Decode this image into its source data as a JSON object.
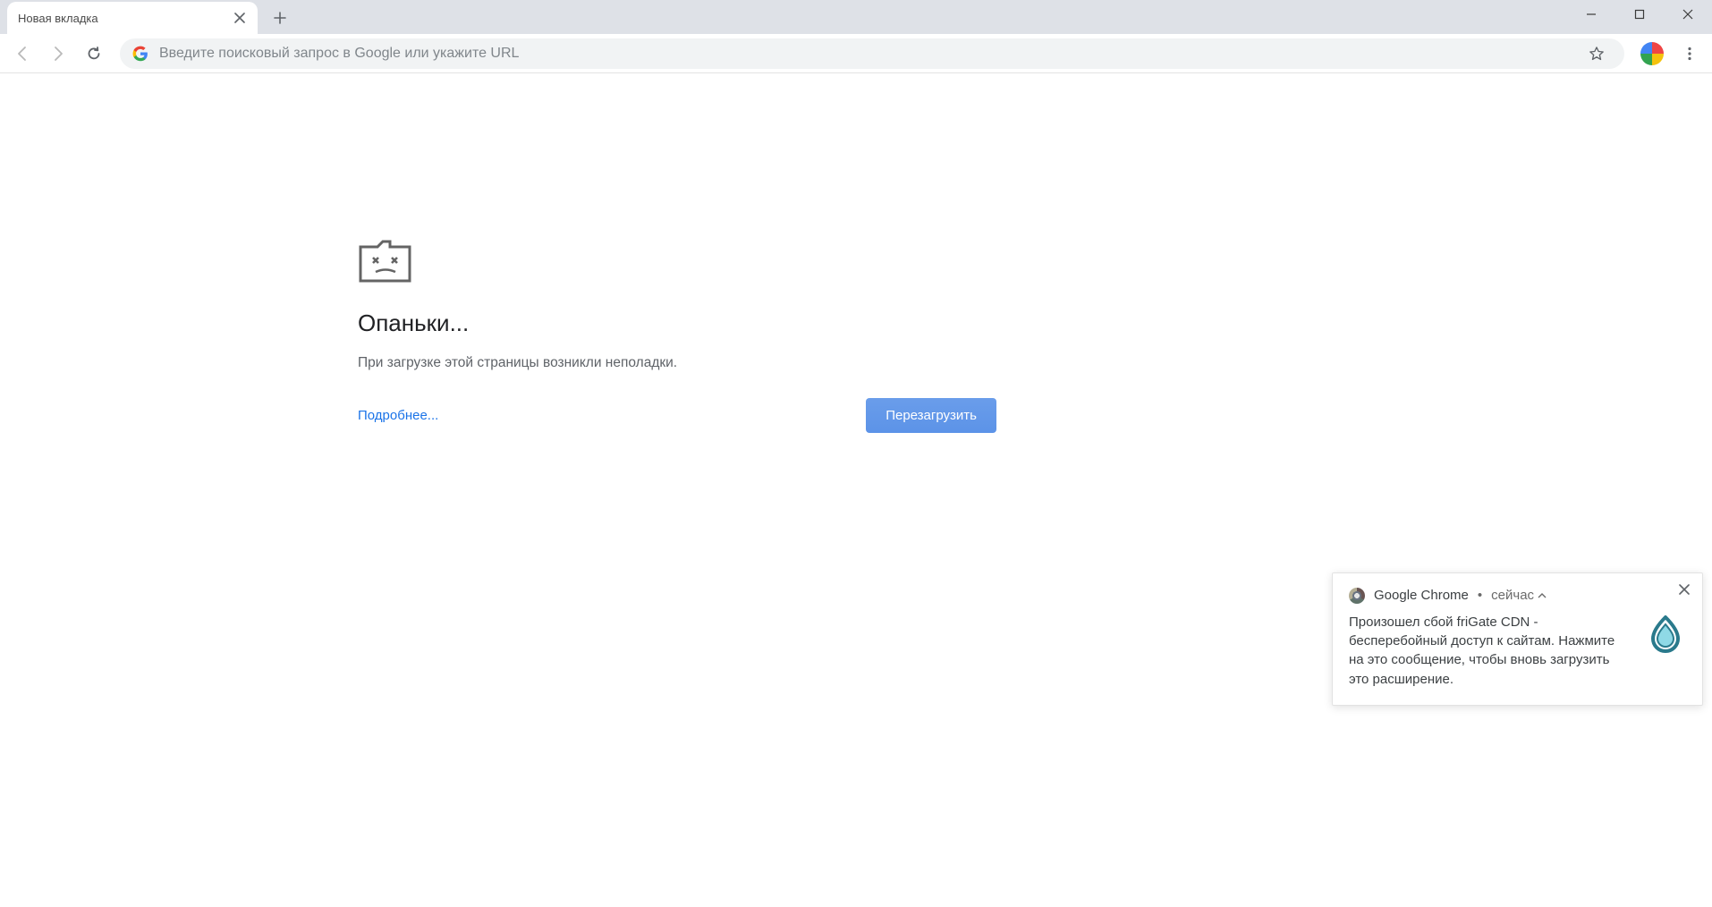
{
  "tab": {
    "title": "Новая вкладка"
  },
  "omnibox": {
    "placeholder": "Введите поисковый запрос в Google или укажите URL"
  },
  "error": {
    "title": "Опаньки...",
    "message": "При загрузке этой страницы возникли неполадки.",
    "learn_more": "Подробнее...",
    "reload": "Перезагрузить"
  },
  "toast": {
    "app": "Google Chrome",
    "time": "сейчас",
    "body": "Произошел сбой friGate CDN - бесперебойный доступ к сайтам. Нажмите на это сообщение, чтобы вновь загрузить это расширение."
  }
}
